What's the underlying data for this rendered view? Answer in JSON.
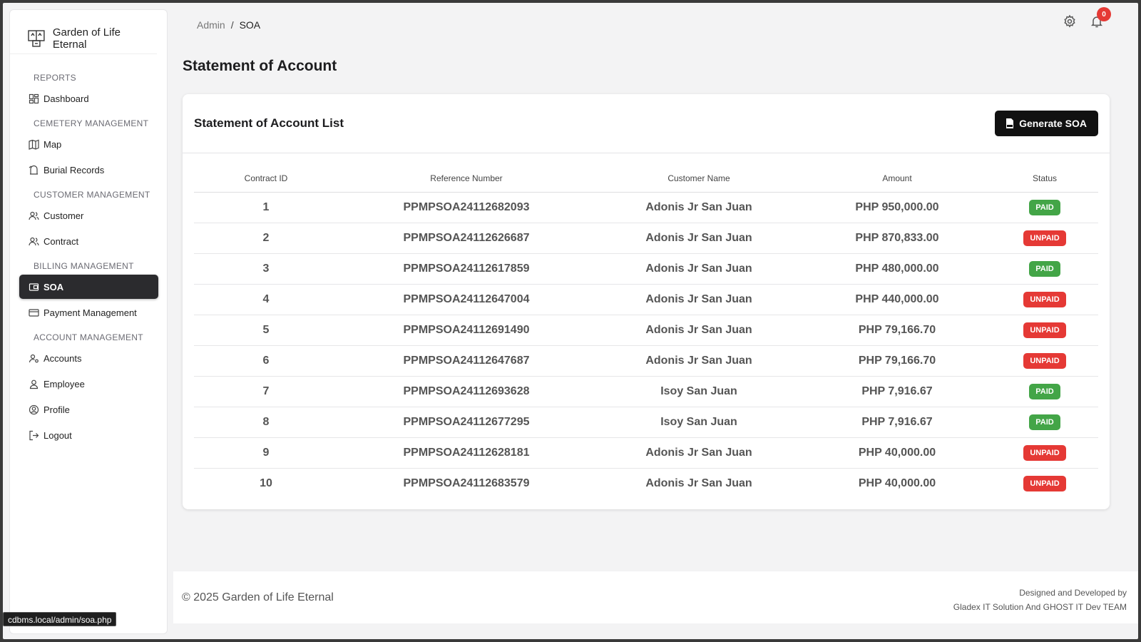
{
  "brand": {
    "name": "Garden of Life Eternal",
    "logo_icon": "cemetery-plot-icon"
  },
  "sidebar": {
    "sections": [
      {
        "title": "REPORTS",
        "items": [
          {
            "label": "Dashboard",
            "icon": "dashboard-icon"
          }
        ]
      },
      {
        "title": "CEMETERY MANAGEMENT",
        "items": [
          {
            "label": "Map",
            "icon": "map-icon"
          },
          {
            "label": "Burial Records",
            "icon": "burial-icon"
          }
        ]
      },
      {
        "title": "CUSTOMER MANAGEMENT",
        "items": [
          {
            "label": "Customer",
            "icon": "users-icon"
          },
          {
            "label": "Contract",
            "icon": "users-icon"
          }
        ]
      },
      {
        "title": "BILLING MANAGEMENT",
        "items": [
          {
            "label": "SOA",
            "icon": "wallet-icon",
            "active": true
          },
          {
            "label": "Payment Management",
            "icon": "credit-card-icon"
          }
        ]
      },
      {
        "title": "ACCOUNT MANAGEMENT",
        "items": [
          {
            "label": "Accounts",
            "icon": "user-settings-icon"
          },
          {
            "label": "Employee",
            "icon": "user-icon"
          },
          {
            "label": "Profile",
            "icon": "profile-circle-icon"
          },
          {
            "label": "Logout",
            "icon": "logout-icon"
          }
        ]
      }
    ]
  },
  "breadcrumb": {
    "root": "Admin",
    "separator": "/",
    "current": "SOA"
  },
  "topbar": {
    "notification_count": "0"
  },
  "page": {
    "title": "Statement of Account"
  },
  "card": {
    "title": "Statement of Account List",
    "generate_button": "Generate SOA",
    "columns": [
      "Contract ID",
      "Reference Number",
      "Customer Name",
      "Amount",
      "Status"
    ],
    "rows": [
      {
        "id": "1",
        "ref": "PPMPSOA24112682093",
        "customer": "Adonis Jr San Juan",
        "amount": "PHP 950,000.00",
        "status": "PAID"
      },
      {
        "id": "2",
        "ref": "PPMPSOA24112626687",
        "customer": "Adonis Jr San Juan",
        "amount": "PHP 870,833.00",
        "status": "UNPAID"
      },
      {
        "id": "3",
        "ref": "PPMPSOA24112617859",
        "customer": "Adonis Jr San Juan",
        "amount": "PHP 480,000.00",
        "status": "PAID"
      },
      {
        "id": "4",
        "ref": "PPMPSOA24112647004",
        "customer": "Adonis Jr San Juan",
        "amount": "PHP 440,000.00",
        "status": "UNPAID"
      },
      {
        "id": "5",
        "ref": "PPMPSOA24112691490",
        "customer": "Adonis Jr San Juan",
        "amount": "PHP 79,166.70",
        "status": "UNPAID"
      },
      {
        "id": "6",
        "ref": "PPMPSOA24112647687",
        "customer": "Adonis Jr San Juan",
        "amount": "PHP 79,166.70",
        "status": "UNPAID"
      },
      {
        "id": "7",
        "ref": "PPMPSOA24112693628",
        "customer": "Isoy San Juan",
        "amount": "PHP 7,916.67",
        "status": "PAID"
      },
      {
        "id": "8",
        "ref": "PPMPSOA24112677295",
        "customer": "Isoy San Juan",
        "amount": "PHP 7,916.67",
        "status": "PAID"
      },
      {
        "id": "9",
        "ref": "PPMPSOA24112628181",
        "customer": "Adonis Jr San Juan",
        "amount": "PHP 40,000.00",
        "status": "UNPAID"
      },
      {
        "id": "10",
        "ref": "PPMPSOA24112683579",
        "customer": "Adonis Jr San Juan",
        "amount": "PHP 40,000.00",
        "status": "UNPAID"
      }
    ]
  },
  "footer": {
    "copyright": "© 2025 Garden of Life Eternal",
    "credit_line1": "Designed and Developed by",
    "credit_line2": "Gladex IT Solution And GHOST IT Dev TEAM"
  },
  "status_bar": {
    "url": "cdbms.local/admin/soa.php"
  },
  "colors": {
    "paid": "#43a547",
    "unpaid": "#e53935",
    "active_nav": "#2b2b2e"
  }
}
